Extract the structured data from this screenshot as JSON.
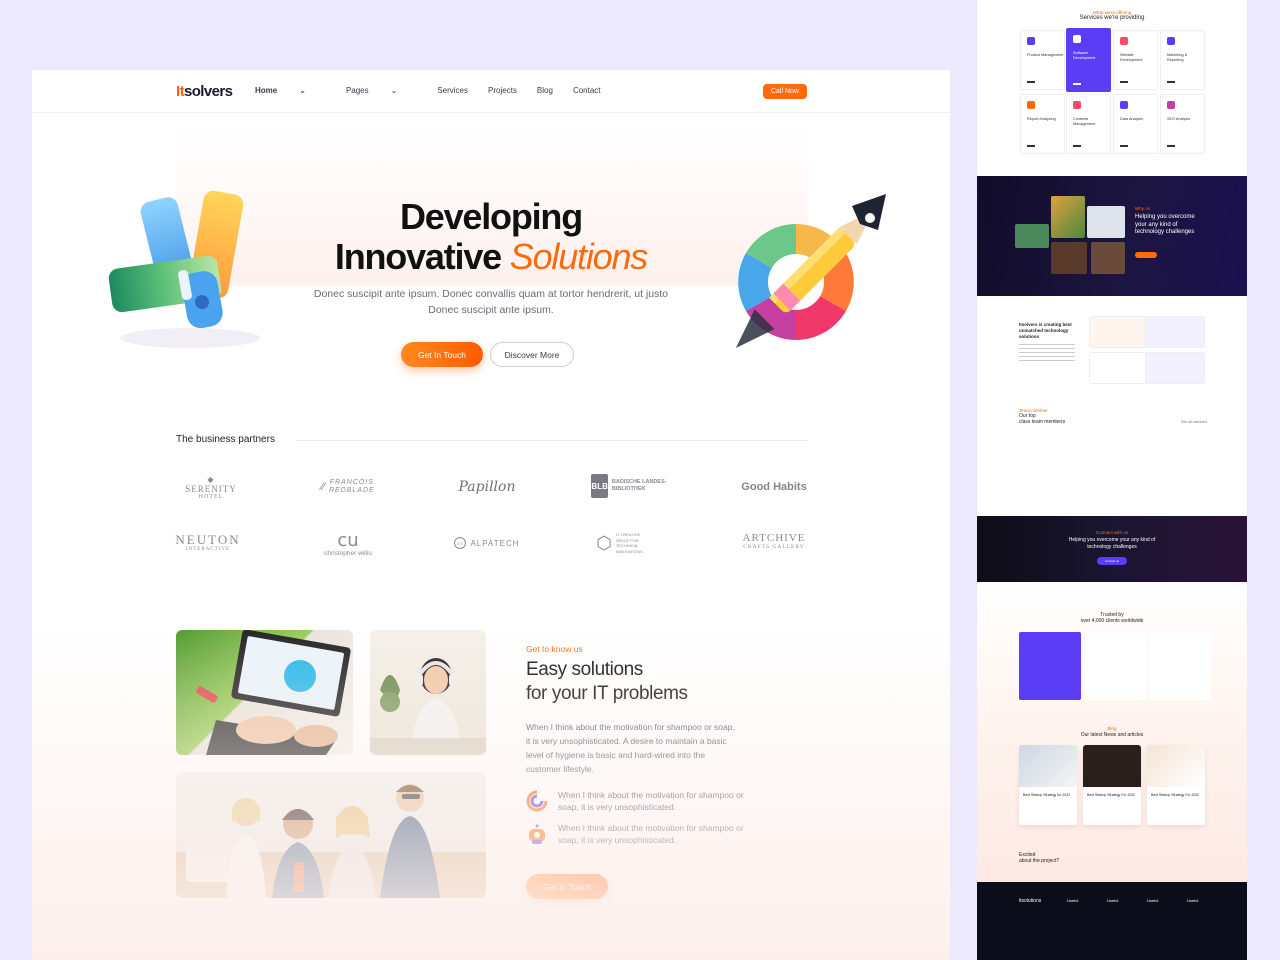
{
  "brand": {
    "logo_i": "It",
    "logo_rest": "solvers",
    "accent": "#ff6a0b"
  },
  "nav": {
    "items": [
      {
        "label": "Home",
        "chevron": "⌄",
        "active": true
      },
      {
        "label": "Pages",
        "chevron": "⌄",
        "active": false
      },
      {
        "label": "Services",
        "chevron": "",
        "active": false
      },
      {
        "label": "Projects",
        "chevron": "",
        "active": false
      },
      {
        "label": "Blog",
        "chevron": "",
        "active": false
      },
      {
        "label": "Contact",
        "chevron": "",
        "active": false
      }
    ],
    "cta": "Call Now"
  },
  "hero": {
    "line1": "Developing",
    "line2_a": "Innovative ",
    "line2_b": "Solutions",
    "para": "Donec suscipit ante ipsum. Donec convallis quam at tortor hendrerit, ut justo Donec suscipit ante ipsum.",
    "primary_btn": "Get In Touch",
    "secondary_btn": "Discover More"
  },
  "partners": {
    "title": "The business partners",
    "logos": [
      {
        "a": "SERENITY",
        "b": "HOTEL"
      },
      {
        "a": "FRANCOIS",
        "b": "REDBLADE"
      },
      {
        "a": "Papillon",
        "b": ""
      },
      {
        "a": "BADISCHE LANDES-",
        "b": "BIBLIOTHEK"
      },
      {
        "a": "Good Habits",
        "b": ""
      },
      {
        "a": "NEUTON",
        "b": "INTERACTIVE"
      },
      {
        "a": "christopher willis",
        "b": ""
      },
      {
        "a": "ALPATECH",
        "b": ""
      },
      {
        "a": "IT CREATIVE",
        "b": "SPACE FOR TECHNICAL INNOVATIONS"
      },
      {
        "a": "ARTCHIVE",
        "b": "CRAFTS GALLERY"
      }
    ]
  },
  "about": {
    "eyebrow": "Get to know us",
    "title_1": "Easy solutions",
    "title_2": "for your IT problems",
    "para": "When I think about the motivation for shampoo or soap, it is very unsophisticated. A desire to maintain a basic level of hygiene is basic and hard-wired into the customer lifestyle.",
    "features": [
      "When I think about the motivation for shampoo or soap, it is very unsophisticated.",
      "When I think about the motivation for shampoo or soap, it is very unsophisticated."
    ],
    "cta": "Get In Touch"
  },
  "strip": {
    "services_eyebrow": "What we're offering",
    "services_title": "Services we're providing",
    "service_cards": [
      "Product Management",
      "Software Development",
      "Website Development",
      "Marketing & Reporting",
      "Report Analysing",
      "Contents Management",
      "Data Analysis",
      "SEO Analysis"
    ],
    "dark1_eyebrow": "Why us",
    "dark1_title": "Helping you overcome your any kind of technology challenges",
    "about_title": "Itsolvers is creating best unmatched technology solutions",
    "team_eyebrow": "Team member",
    "team_title_1": "Our top",
    "team_title_2": "class team members",
    "team_link": "See all members",
    "dark2_eyebrow": "Connect with us",
    "dark2_title": "Helping you overcome your any kind of technology challenges",
    "dark2_btn": "Contact us",
    "testimonial_title_1": "Trusted by",
    "testimonial_title_2": "over 4,000 clients worldwide",
    "news_eyebrow": "Blog",
    "news_title": "Our latest News and articles",
    "news_items": [
      "Best Startup Strategy for 2022",
      "Best Startup Strategy For 2022",
      "Best Startup Strategy For 2022"
    ],
    "footer_cta_1": "Excited",
    "footer_cta_2": "about the project?",
    "footer_logo": "itsolutions",
    "footer_cols": [
      "Useful",
      "Useful",
      "Useful",
      "Useful"
    ]
  }
}
